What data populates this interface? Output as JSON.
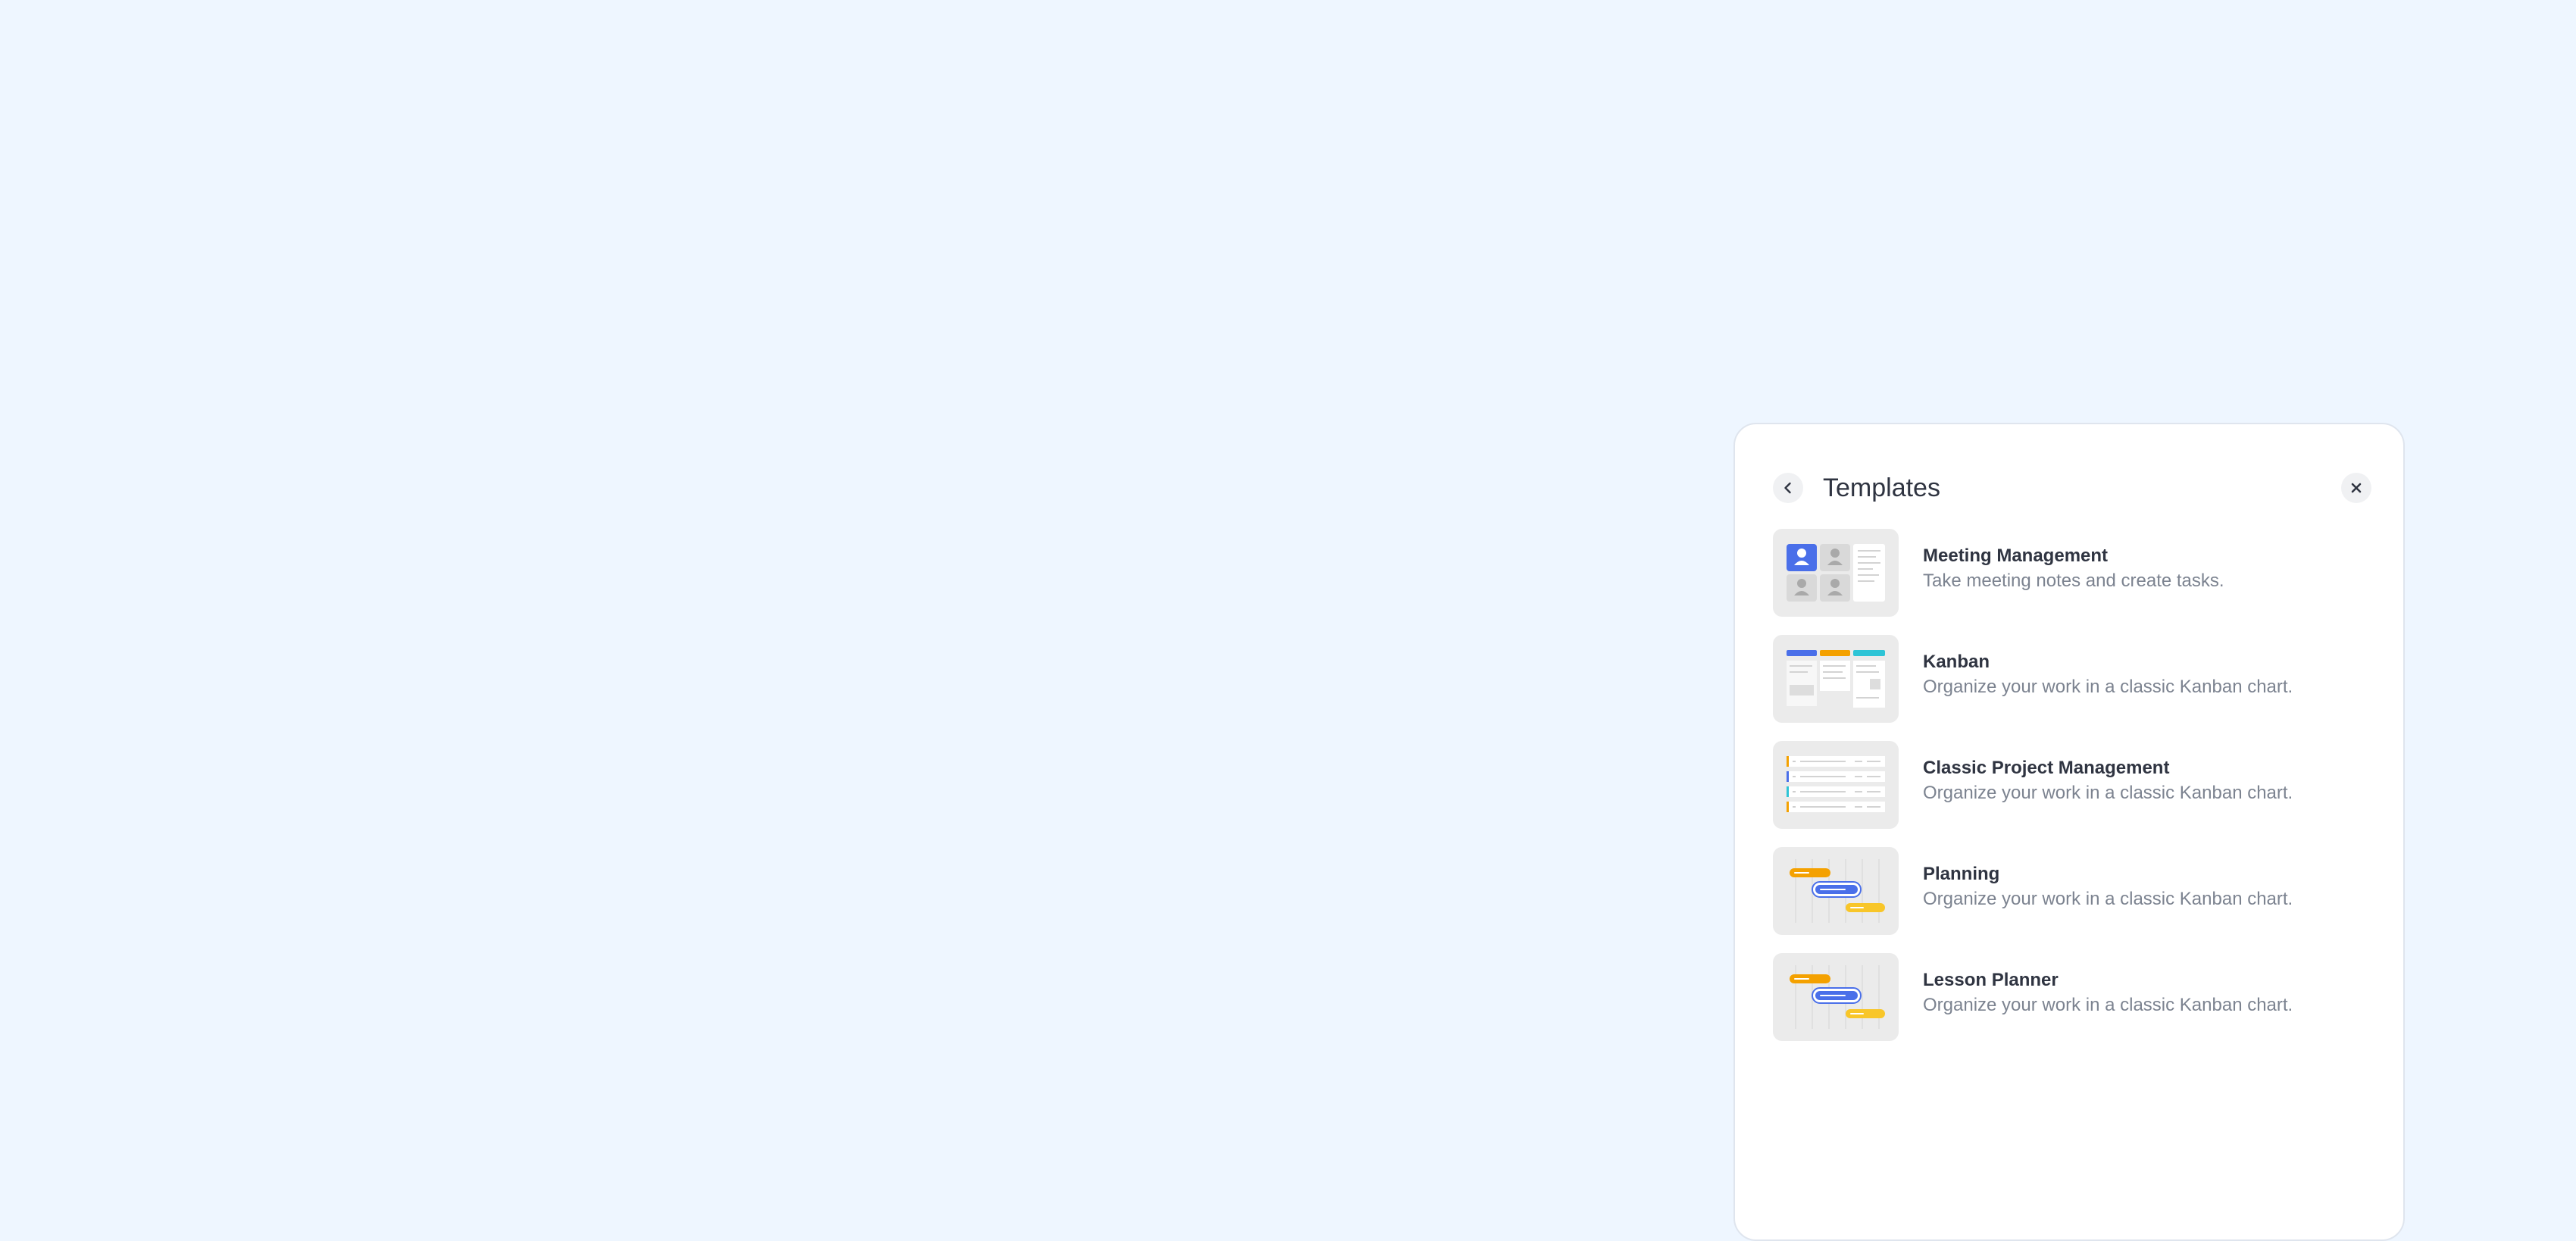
{
  "panel": {
    "title": "Templates",
    "back_icon": "chevron-left-icon",
    "close_icon": "close-icon"
  },
  "templates": [
    {
      "title": "Meeting Management",
      "description": "Take meeting notes and create tasks.",
      "thumbnail": "meeting-thumbnail"
    },
    {
      "title": "Kanban",
      "description": "Organize your work in a classic Kanban chart.",
      "thumbnail": "kanban-thumbnail"
    },
    {
      "title": "Classic Project Management",
      "description": "Organize your work in a classic Kanban chart.",
      "thumbnail": "project-list-thumbnail"
    },
    {
      "title": "Planning",
      "description": "Organize your work in a classic Kanban chart.",
      "thumbnail": "gantt-thumbnail"
    },
    {
      "title": "Lesson Planner",
      "description": "Organize your work in a classic Kanban chart.",
      "thumbnail": "gantt-thumbnail"
    }
  ],
  "colors": {
    "background": "#eef6ff",
    "panel": "#ffffff",
    "accent_blue": "#4a6fe9",
    "accent_orange": "#f4a100",
    "accent_teal": "#2ec4d6",
    "accent_yellow": "#f8c629"
  }
}
